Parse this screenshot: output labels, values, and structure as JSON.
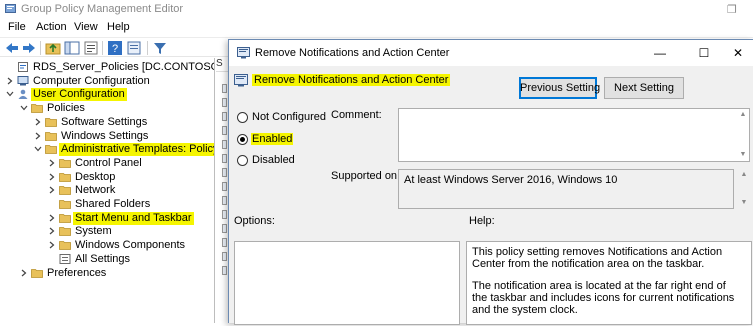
{
  "gp_window": {
    "title": "Group Policy Management Editor",
    "restore_glyph": "❐",
    "menu": [
      "File",
      "Action",
      "View",
      "Help"
    ]
  },
  "tree": {
    "items": [
      {
        "label": "RDS_Server_Policies [DC.CONTOSO.COM] Polic",
        "highlighted": false
      },
      {
        "label": "Computer Configuration",
        "highlighted": false
      },
      {
        "label": "User Configuration",
        "highlighted": true
      },
      {
        "label": "Policies",
        "highlighted": false
      },
      {
        "label": "Software Settings",
        "highlighted": false
      },
      {
        "label": "Windows Settings",
        "highlighted": false
      },
      {
        "label": "Administrative Templates: Policy def",
        "highlighted": true
      },
      {
        "label": "Control Panel",
        "highlighted": false
      },
      {
        "label": "Desktop",
        "highlighted": false
      },
      {
        "label": "Network",
        "highlighted": false
      },
      {
        "label": "Shared Folders",
        "highlighted": false
      },
      {
        "label": "Start Menu and Taskbar",
        "highlighted": true
      },
      {
        "label": "System",
        "highlighted": false
      },
      {
        "label": "Windows Components",
        "highlighted": false
      },
      {
        "label": "All Settings",
        "highlighted": false
      },
      {
        "label": "Preferences",
        "highlighted": false
      }
    ]
  },
  "right_pane": {
    "header": "S"
  },
  "dialog": {
    "title": "Remove Notifications and Action Center",
    "setting_name": "Remove Notifications and Action Center",
    "previous_button": "Previous Setting",
    "next_button": "Next Setting",
    "minimize_glyph": "—",
    "maximize_glyph": "☐",
    "close_glyph": "✕",
    "options": {
      "not_configured": "Not Configured",
      "enabled": "Enabled",
      "disabled": "Disabled",
      "selected": "enabled"
    },
    "comment_label": "Comment:",
    "comment_value": "",
    "supported_label": "Supported on:",
    "supported_value": "At least Windows Server 2016, Windows 10",
    "options_label": "Options:",
    "help_label": "Help:",
    "help_paragraphs": [
      "This policy setting removes Notifications and Action Center from the notification area on the taskbar.",
      "The notification area is located at the far right end of the taskbar and includes icons for current notifications and the system clock."
    ]
  },
  "colors": {
    "highlight": "#f5f500",
    "folder": "#e8c15a",
    "accent": "#0078d7"
  }
}
